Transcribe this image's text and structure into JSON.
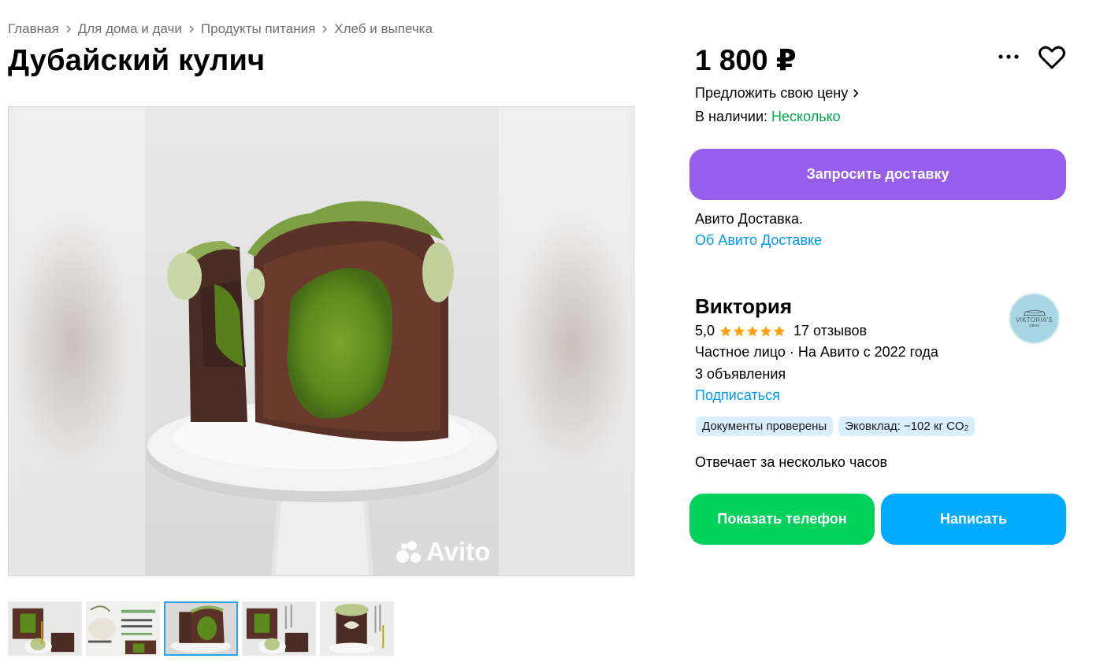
{
  "breadcrumbs": [
    {
      "label": "Главная"
    },
    {
      "label": "Для дома и дачи"
    },
    {
      "label": "Продукты питания"
    },
    {
      "label": "Хлеб и выпечка"
    }
  ],
  "listing": {
    "title": "Дубайский кулич",
    "price": "1 800 ₽",
    "offer_price_label": "Предложить свою цену",
    "availability_label": "В наличии: ",
    "availability_value": "Несколько",
    "watermark": "Avito"
  },
  "gallery": {
    "active_index": 2,
    "thumbnails": [
      {
        "label": "photo-1"
      },
      {
        "label": "photo-2"
      },
      {
        "label": "photo-3"
      },
      {
        "label": "photo-4"
      },
      {
        "label": "photo-5"
      }
    ]
  },
  "delivery": {
    "button_label": "Запросить доставку",
    "text": "Авито Доставка.",
    "link": "Об Авито Доставке"
  },
  "seller": {
    "name": "Виктория",
    "rating": "5,0",
    "stars": 5,
    "reviews": "17 отзывов",
    "info": "Частное лицо · На Авито с 2022 года",
    "ads_count": "3 объявления",
    "subscribe": "Подписаться",
    "avatar_text": "VIKTORIA'S",
    "avatar_sub": "cakes",
    "badges": [
      {
        "label": "Документы проверены"
      },
      {
        "label": "Эковклад: −102 кг CO",
        "sub": "2"
      }
    ],
    "response_time": "Отвечает за несколько часов"
  },
  "actions": {
    "show_phone": "Показать телефон",
    "write": "Написать"
  },
  "colors": {
    "delivery_button": "#965eeb",
    "phone_button": "#02d15c",
    "write_button": "#00aaff",
    "link": "#0099f7",
    "in_stock": "#02a84c",
    "star": "#ffa000",
    "badge_bg": "#d9efff"
  },
  "icons": {
    "more": "more-dots-icon",
    "favorite": "heart-icon",
    "chevron": "chevron-right-icon",
    "star": "star-icon"
  }
}
